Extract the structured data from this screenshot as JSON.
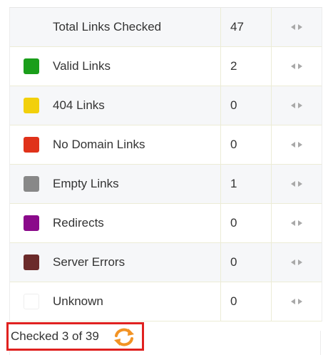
{
  "rows": [
    {
      "label": "Total Links Checked",
      "value": "47",
      "color": null,
      "style": "alt"
    },
    {
      "label": "Valid Links",
      "value": "2",
      "color": "#1a9e1a",
      "style": "plain"
    },
    {
      "label": "404 Links",
      "value": "0",
      "color": "#f2d00b",
      "style": "alt"
    },
    {
      "label": "No Domain Links",
      "value": "0",
      "color": "#e0321a",
      "style": "plain"
    },
    {
      "label": "Empty Links",
      "value": "1",
      "color": "#888888",
      "style": "alt"
    },
    {
      "label": "Redirects",
      "value": "0",
      "color": "#8a0a8a",
      "style": "plain"
    },
    {
      "label": "Server Errors",
      "value": "0",
      "color": "#6b2a2a",
      "style": "alt"
    },
    {
      "label": "Unknown",
      "value": "0",
      "color": "#ffffff",
      "style": "plain"
    }
  ],
  "footer": {
    "checked_text": "Checked 3 of 39"
  },
  "icons": {
    "refresh": "refresh-icon",
    "arrows": "left-right-arrows-icon"
  },
  "colors": {
    "highlight_border": "#e0211f",
    "refresh_icon": "#f29324"
  }
}
